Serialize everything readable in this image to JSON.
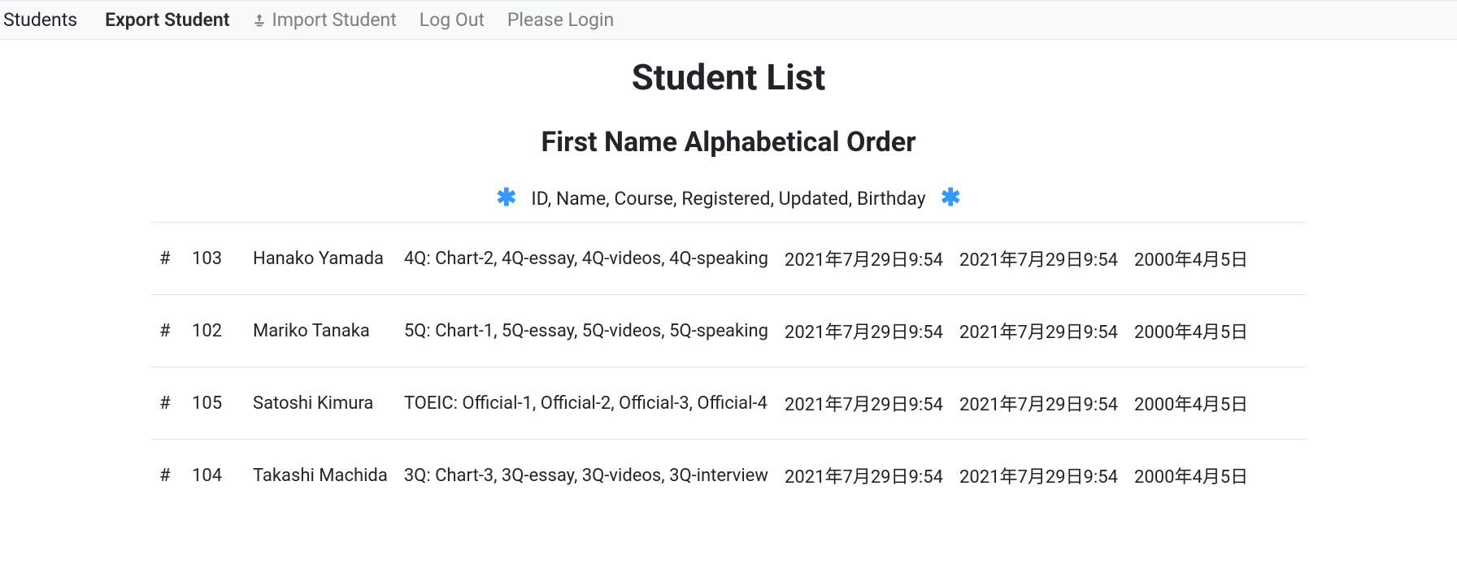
{
  "nav": {
    "brand": "Students",
    "export": "Export Student",
    "import": "Import Student",
    "logout": "Log Out",
    "login": "Please Login"
  },
  "page": {
    "title": "Student List",
    "sort_title": "First Name Alphabetical Order",
    "columns_label": "ID, Name, Course, Registered, Updated, Birthday"
  },
  "table": {
    "rows": [
      {
        "hash": "#",
        "id": "103",
        "name": "Hanako Yamada",
        "course": "4Q: Chart-2, 4Q-essay, 4Q-videos, 4Q-speaking",
        "registered": "2021年7月29日9:54",
        "updated": "2021年7月29日9:54",
        "birthday": "2000年4月5日"
      },
      {
        "hash": "#",
        "id": "102",
        "name": "Mariko Tanaka",
        "course": "5Q: Chart-1, 5Q-essay, 5Q-videos, 5Q-speaking",
        "registered": "2021年7月29日9:54",
        "updated": "2021年7月29日9:54",
        "birthday": "2000年4月5日"
      },
      {
        "hash": "#",
        "id": "105",
        "name": "Satoshi Kimura",
        "course": "TOEIC: Official-1, Official-2, Official-3, Official-4",
        "registered": "2021年7月29日9:54",
        "updated": "2021年7月29日9:54",
        "birthday": "2000年4月5日"
      },
      {
        "hash": "#",
        "id": "104",
        "name": "Takashi Machida",
        "course": "3Q: Chart-3, 3Q-essay, 3Q-videos, 3Q-interview",
        "registered": "2021年7月29日9:54",
        "updated": "2021年7月29日9:54",
        "birthday": "2000年4月5日"
      }
    ]
  }
}
